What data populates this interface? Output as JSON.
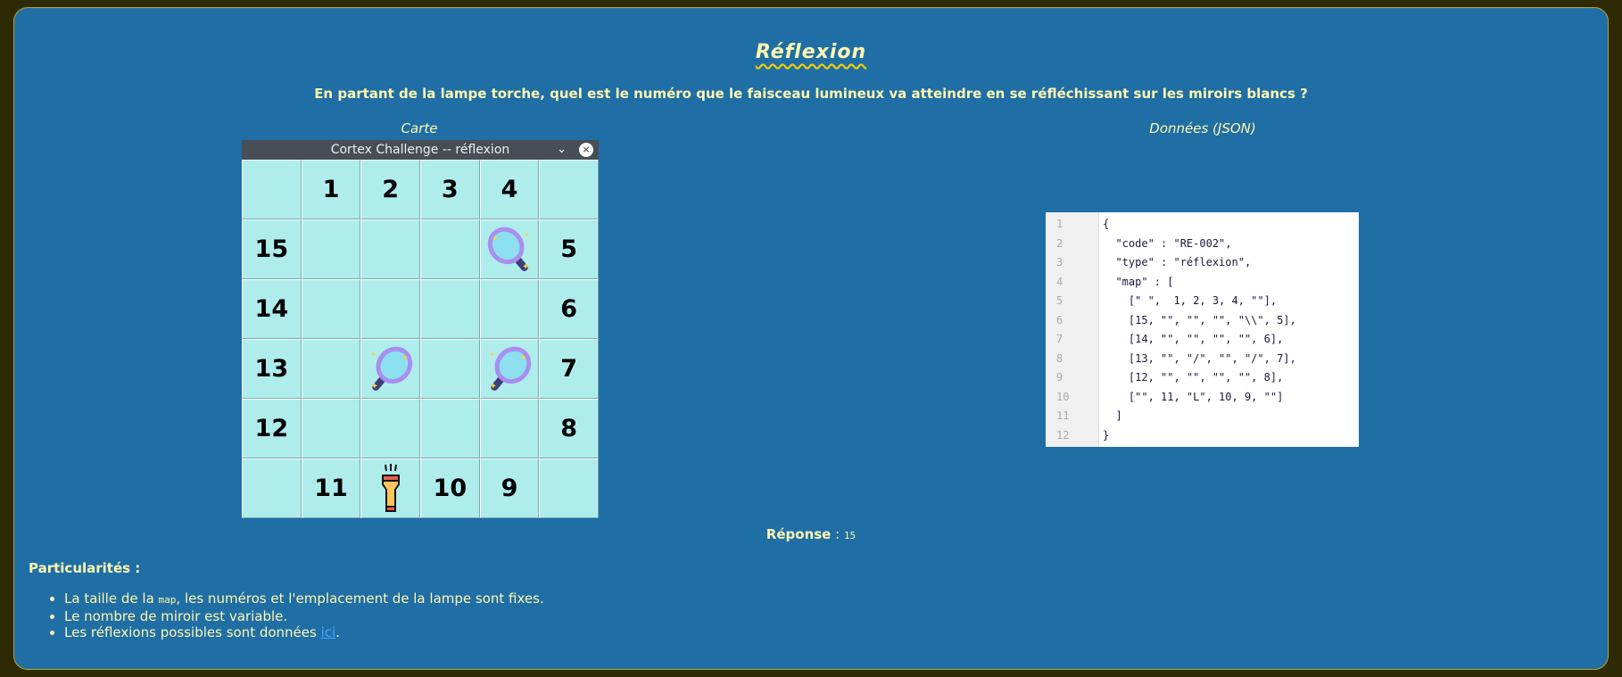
{
  "title": "Réflexion",
  "question": "En partant de la lampe torche, quel est le numéro que le faisceau lumineux va atteindre en se réfléchissant sur les miroirs blancs ?",
  "map_label": "Carte",
  "json_label": "Données (JSON)",
  "window_title": "Cortex Challenge -- réflexion",
  "grid": [
    [
      "",
      "1",
      "2",
      "3",
      "4",
      ""
    ],
    [
      "15",
      "",
      "",
      "",
      "\\",
      "5"
    ],
    [
      "14",
      "",
      "",
      "",
      "",
      "6"
    ],
    [
      "13",
      "",
      "/",
      "",
      "/",
      "7"
    ],
    [
      "12",
      "",
      "",
      "",
      "",
      "8"
    ],
    [
      "",
      "11",
      "L",
      "10",
      "9",
      ""
    ]
  ],
  "json_lines": [
    "{",
    "  \"code\" : \"RE-002\",",
    "  \"type\" : \"réflexion\",",
    "  \"map\" : [",
    "    [\" \",  1, 2, 3, 4, \"\"],",
    "    [15, \"\", \"\", \"\", \"\\\\\", 5],",
    "    [14, \"\", \"\", \"\", \"\", 6],",
    "    [13, \"\", \"/\", \"\", \"/\", 7],",
    "    [12, \"\", \"\", \"\", \"\", 8],",
    "    [\"\", 11, \"L\", 10, 9, \"\"]",
    "  ]",
    "}"
  ],
  "answer_label": "Réponse",
  "answer_value": "15",
  "particularites_label": "Particularités :",
  "bullets": {
    "b1_pre": "La taille de la ",
    "b1_code": "map",
    "b1_post": ", les numéros et l'emplacement de la lampe sont fixes.",
    "b2": "Le nombre de miroir est variable.",
    "b3_pre": "Les réflexions possibles sont données ",
    "b3_link": "ici",
    "b3_post": "."
  }
}
